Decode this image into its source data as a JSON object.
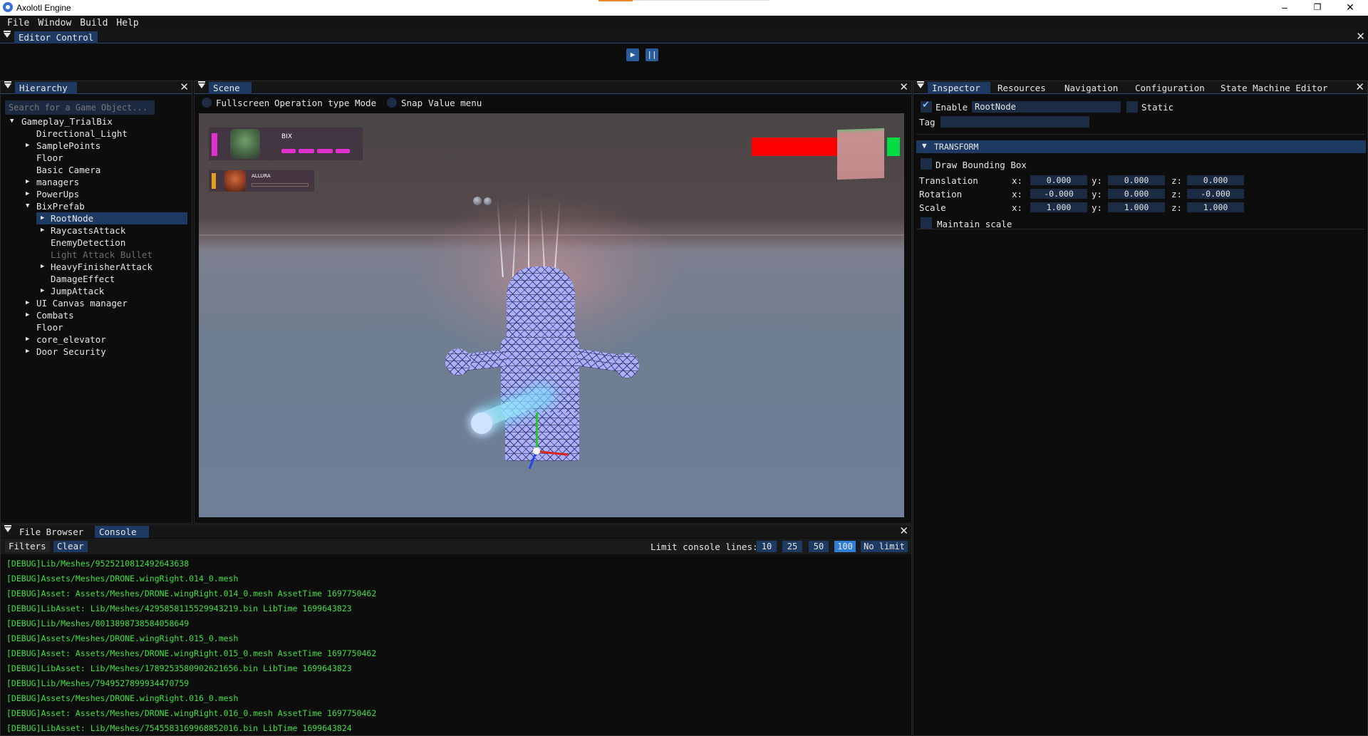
{
  "window": {
    "title": "Axolotl Engine",
    "minimize": "–",
    "maximize": "❐",
    "close": "✕"
  },
  "menu": [
    "File",
    "Window",
    "Build",
    "Help"
  ],
  "editor_control": {
    "tab": "Editor Control",
    "play": "▶",
    "pause": "||",
    "close": "✕"
  },
  "hierarchy": {
    "tab": "Hierarchy",
    "close": "✕",
    "search_placeholder": "Search for a Game Object...",
    "nodes": [
      {
        "label": "Gameplay_TrialBix",
        "arrow": "▼"
      },
      {
        "label": "Directional_Light",
        "arrow": ""
      },
      {
        "label": "SamplePoints",
        "arrow": "▶"
      },
      {
        "label": "Floor",
        "arrow": ""
      },
      {
        "label": "Basic Camera",
        "arrow": ""
      },
      {
        "label": "managers",
        "arrow": "▶"
      },
      {
        "label": "PowerUps",
        "arrow": "▶"
      },
      {
        "label": "BixPrefab",
        "arrow": "▼"
      },
      {
        "label": "RootNode",
        "arrow": "▶"
      },
      {
        "label": "RaycastsAttack",
        "arrow": "▶"
      },
      {
        "label": "EnemyDetection",
        "arrow": ""
      },
      {
        "label": "Light Attack Bullet",
        "arrow": ""
      },
      {
        "label": "HeavyFinisherAttack",
        "arrow": "▶"
      },
      {
        "label": "DamageEffect",
        "arrow": ""
      },
      {
        "label": "JumpAttack",
        "arrow": "▶"
      },
      {
        "label": "UI Canvas manager",
        "arrow": "▶"
      },
      {
        "label": "Combats",
        "arrow": "▶"
      },
      {
        "label": "Floor",
        "arrow": ""
      },
      {
        "label": "core_elevator",
        "arrow": "▶"
      },
      {
        "label": "Door Security",
        "arrow": "▶"
      }
    ]
  },
  "scene": {
    "tab": "Scene",
    "close": "✕",
    "toolbar": {
      "fullscreen": "Fullscreen",
      "operation": "Operation type",
      "mode": "Mode",
      "snap": "Snap",
      "value_menu": "Value menu"
    },
    "hud": {
      "player1": "BIX",
      "player2": "ALLURA"
    }
  },
  "inspector": {
    "tabs": [
      "Inspector",
      "Resources",
      "Navigation",
      "Configuration",
      "State Machine Editor"
    ],
    "close": "✕",
    "enable_label": "Enable",
    "name_value": "RootNode",
    "static_label": "Static",
    "tag_label": "Tag",
    "tag_value": "",
    "transform_header": "TRANSFORM",
    "draw_bbox_label": "Draw Bounding Box",
    "rows": [
      {
        "label": "Translation",
        "x": "0.000",
        "y": "0.000",
        "z": "0.000"
      },
      {
        "label": "Rotation",
        "x": "-0.000",
        "y": "0.000",
        "z": "-0.000"
      },
      {
        "label": "Scale",
        "x": "1.000",
        "y": "1.000",
        "z": "1.000"
      }
    ],
    "axis": {
      "x": "x:",
      "y": "y:",
      "z": "z:"
    },
    "maintain_scale_label": "Maintain scale"
  },
  "bottom": {
    "tabs": [
      "File Browser",
      "Console"
    ],
    "close": "✕",
    "filters": "Filters",
    "clear": "Clear",
    "limit_label": "Limit console lines:",
    "limits": [
      "10",
      "25",
      "50",
      "100",
      "No limit"
    ],
    "active_limit": "100",
    "logs": [
      "[DEBUG]Lib/Meshes/9525210812492643638",
      "[DEBUG]Assets/Meshes/DRONE.wingRight.014_0.mesh",
      "[DEBUG]Asset: Assets/Meshes/DRONE.wingRight.014_0.mesh AssetTime 1697750462",
      "[DEBUG]LibAsset: Lib/Meshes/4295858115529943219.bin LibTime 1699643823",
      "[DEBUG]Lib/Meshes/8013898738584058649",
      "[DEBUG]Assets/Meshes/DRONE.wingRight.015_0.mesh",
      "[DEBUG]Asset: Assets/Meshes/DRONE.wingRight.015_0.mesh AssetTime 1697750462",
      "[DEBUG]LibAsset: Lib/Meshes/1789253580902621656.bin LibTime 1699643823",
      "[DEBUG]Lib/Meshes/7949527899934470759",
      "[DEBUG]Assets/Meshes/DRONE.wingRight.016_0.mesh",
      "[DEBUG]Asset: Assets/Meshes/DRONE.wingRight.016_0.mesh AssetTime 1697750462",
      "[DEBUG]LibAsset: Lib/Meshes/7545583169968852016.bin LibTime 1699643824"
    ]
  },
  "colors": {
    "accent": "#1e3a63",
    "log_green": "#3fe03f",
    "hud_magenta": "#e030d0",
    "health_red": "#ff0000",
    "health_green": "#00dd44"
  }
}
